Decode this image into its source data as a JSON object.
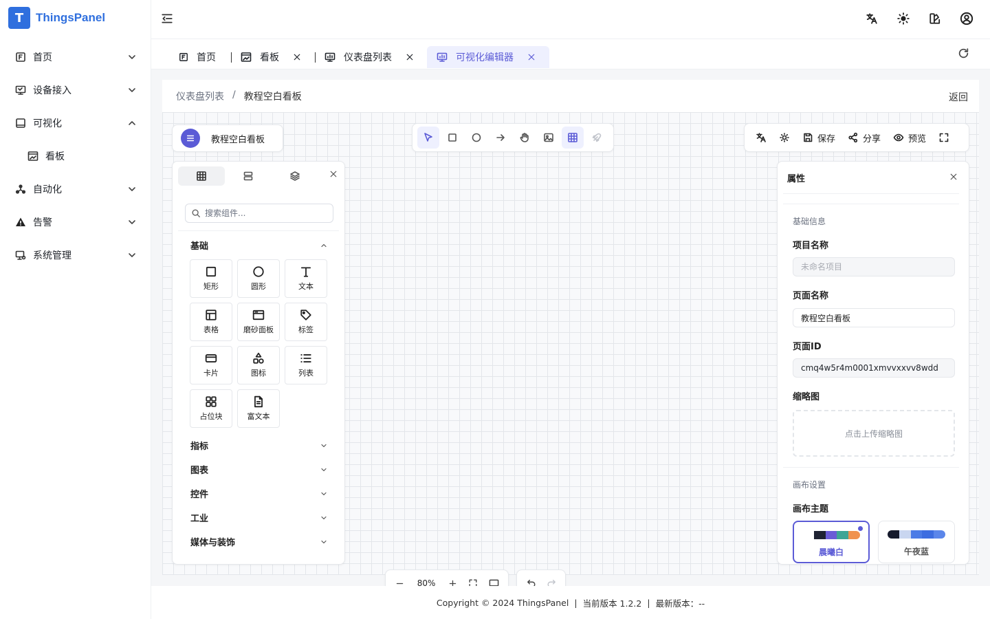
{
  "app": {
    "logo_letter": "T",
    "name": "ThingsPanel"
  },
  "sidebar": {
    "items": [
      {
        "label": "首页"
      },
      {
        "label": "设备接入"
      },
      {
        "label": "可视化"
      },
      {
        "label": "看板"
      },
      {
        "label": "自动化"
      },
      {
        "label": "告警"
      },
      {
        "label": "系统管理"
      }
    ]
  },
  "tabs": [
    {
      "label": "首页"
    },
    {
      "label": "看板"
    },
    {
      "label": "仪表盘列表"
    },
    {
      "label": "可视化编辑器"
    }
  ],
  "breadcrumb": {
    "parent": "仪表盘列表",
    "separator": "/",
    "current": "教程空白看板",
    "back": "返回"
  },
  "editor": {
    "title": "教程空白看板",
    "right_tools": {
      "save": "保存",
      "share": "分享",
      "preview": "预览"
    },
    "zoom": "80%"
  },
  "components": {
    "search_placeholder": "搜索组件...",
    "sections": [
      {
        "label": "基础"
      },
      {
        "label": "指标"
      },
      {
        "label": "图表"
      },
      {
        "label": "控件"
      },
      {
        "label": "工业"
      },
      {
        "label": "媒体与装饰"
      }
    ],
    "basic": [
      {
        "label": "矩形",
        "icon": "square-icon"
      },
      {
        "label": "圆形",
        "icon": "circle-icon"
      },
      {
        "label": "文本",
        "icon": "text-icon"
      },
      {
        "label": "表格",
        "icon": "table-icon"
      },
      {
        "label": "磨砂面板",
        "icon": "panel-icon"
      },
      {
        "label": "标签",
        "icon": "tag-icon"
      },
      {
        "label": "卡片",
        "icon": "card-icon"
      },
      {
        "label": "图标",
        "icon": "shapes-icon"
      },
      {
        "label": "列表",
        "icon": "list-icon"
      },
      {
        "label": "占位块",
        "icon": "grid-icon"
      },
      {
        "label": "富文本",
        "icon": "document-icon"
      }
    ]
  },
  "properties": {
    "title": "属性",
    "basic_group": "基础信息",
    "project_name_label": "项目名称",
    "project_name_placeholder": "未命名项目",
    "page_name_label": "页面名称",
    "page_name_value": "教程空白看板",
    "page_id_label": "页面ID",
    "page_id_value": "cmq4w5r4m0001xmvvxxvv8wdd",
    "thumbnail_label": "缩略图",
    "thumbnail_upload": "点击上传缩略图",
    "canvas_group": "画布设置",
    "theme_label": "画布主题",
    "themes": [
      {
        "name": "晨曦白",
        "colors": [
          "#ffffff",
          "#1f2333",
          "#6a5cd6",
          "#3fa595",
          "#f0924f"
        ]
      },
      {
        "name": "午夜蓝",
        "colors": [
          "#151a2c",
          "#c9d6f0",
          "#4c7ce6",
          "#3d6de0",
          "#5b86ea"
        ]
      }
    ],
    "accent": "#5b5bd6"
  },
  "footer": {
    "copyright": "Copyright © 2024 ThingsPanel",
    "current_version": "当前版本 1.2.2",
    "latest_version": "最新版本：--"
  }
}
